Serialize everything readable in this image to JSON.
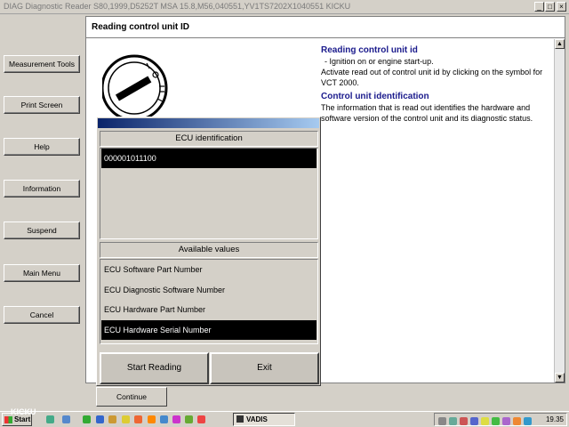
{
  "window": {
    "title": "DIAG Diagnostic Reader S80,1999,D5252T MSA 15.8,M56,040551,YV1TS7202X1040551 KICKU"
  },
  "sidebar": {
    "items": [
      {
        "label": "Measurement Tools"
      },
      {
        "label": "Print Screen"
      },
      {
        "label": "Help"
      },
      {
        "label": "Information"
      },
      {
        "label": "Suspend"
      },
      {
        "label": "Main Menu"
      },
      {
        "label": "Cancel"
      }
    ]
  },
  "main": {
    "header": "Reading control unit ID"
  },
  "info": {
    "section1_title": "Reading control unit id",
    "bullet": "-  Ignition on or engine start-up.",
    "section1_text": "Activate read out of control unit id by clicking on the symbol for VCT 2000.",
    "section2_title": "Control unit identification",
    "section2_text": "The information that is read out identifies the hardware and software version of the control unit and its diagnostic status."
  },
  "dialog": {
    "ecu_header": "ECU identification",
    "ecu_value": "000001011100",
    "values_header": "Available values",
    "values": [
      {
        "label": "ECU Software Part Number"
      },
      {
        "label": "ECU Diagnostic Software Number"
      },
      {
        "label": "ECU Hardware Part Number"
      },
      {
        "label": "ECU Hardware Serial Number"
      }
    ],
    "start_label": "Start Reading",
    "exit_label": "Exit"
  },
  "continue_label": "Continue",
  "taskbar": {
    "start_label": "Start",
    "task_label": "VADIS",
    "clock": "19.35",
    "watermark": "KICKU"
  },
  "colors": {
    "section_title": "#1a1a8c",
    "selected_row": "#000000",
    "dialog_title_gradient": [
      "#0a246a",
      "#a6caf0"
    ]
  }
}
